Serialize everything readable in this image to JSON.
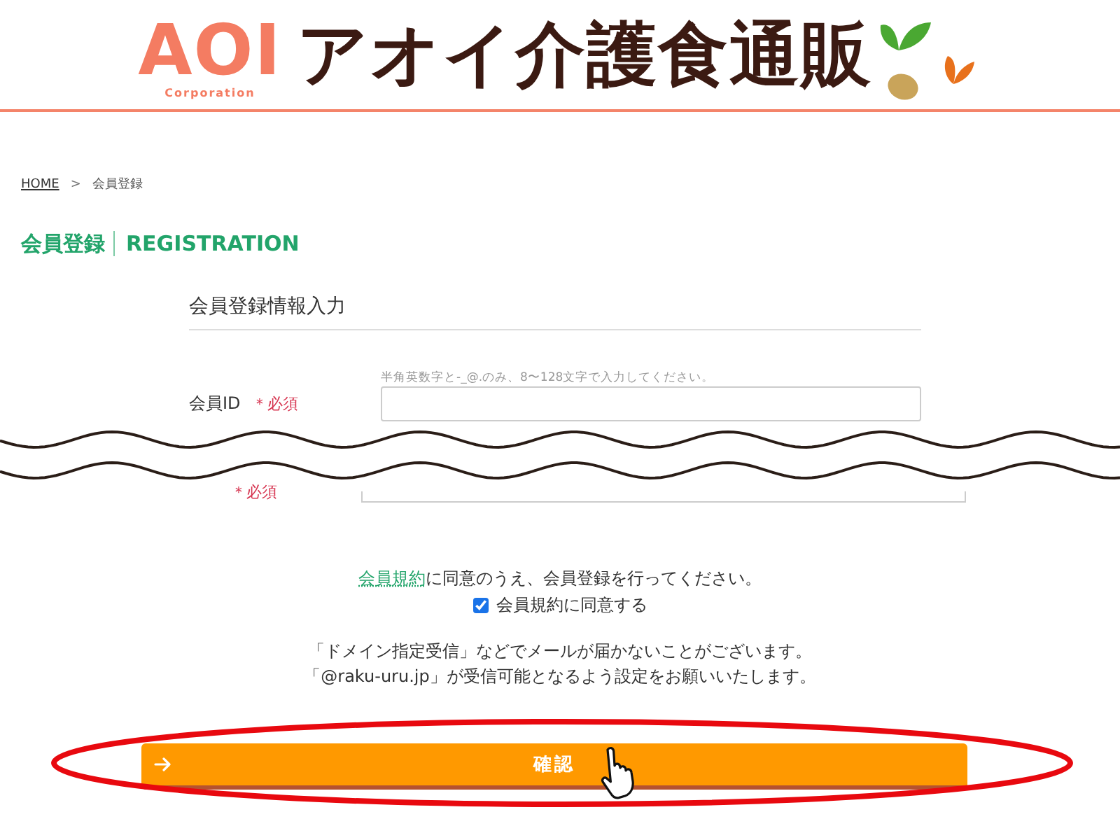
{
  "header": {
    "logo": "AOI",
    "logo_sub": "Corporation",
    "site_title": "アオイ介護食通販"
  },
  "breadcrumb": [
    {
      "label": "HOME",
      "kind": "link"
    },
    {
      "label": ">",
      "kind": "separator"
    },
    {
      "label": "会員登録",
      "kind": "current"
    }
  ],
  "page_heading": {
    "title": "会員登録",
    "subtitle": "REGISTRATION"
  },
  "section_title": "会員登録情報入力",
  "fields": [
    {
      "label": "会員ID",
      "required": "＊必須",
      "hint": "半角英数字と-_@.のみ、8〜128文字で入力してください。"
    }
  ],
  "partial_field": {
    "required": "＊必須"
  },
  "agreement": {
    "link": "会員規約",
    "text": "に同意のうえ、会員登録を行ってください。"
  },
  "consent": {
    "label": "会員規約に同意する",
    "checked": true
  },
  "notice": [
    "「ドメイン指定受信」などでメールが届かないことがございます。",
    "「@raku-uru.jp」が受信可能となるよう設定をお願いいたします。"
  ],
  "submit": {
    "label": "確認"
  }
}
